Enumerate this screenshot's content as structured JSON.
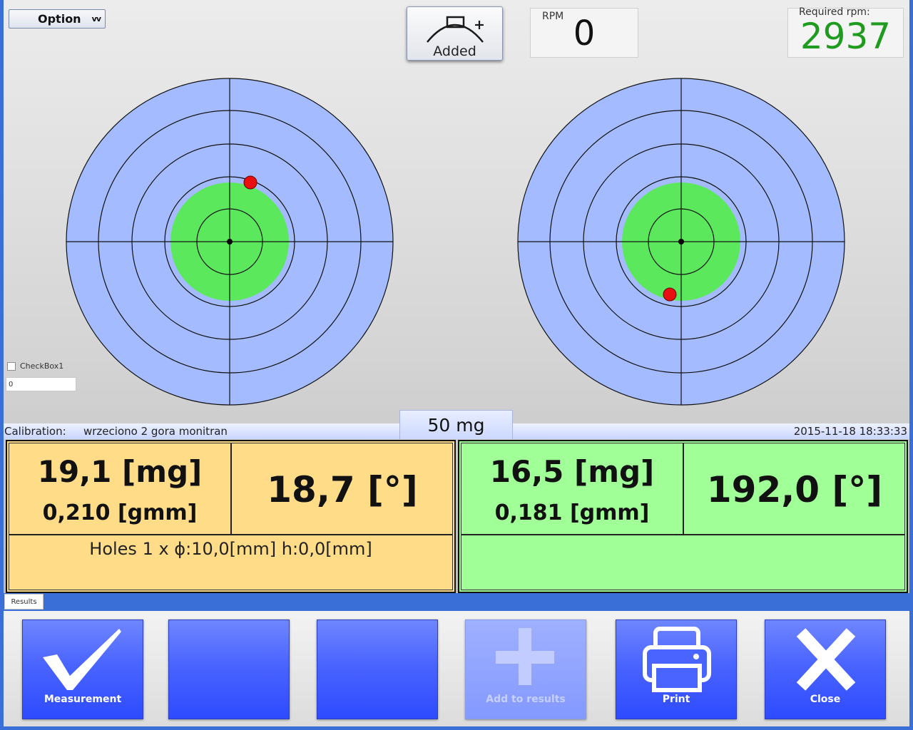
{
  "toolbar": {
    "option_label": "Option",
    "option_chevron": "vv",
    "added_label": "Added"
  },
  "rpm": {
    "caption": "RPM",
    "value": "0"
  },
  "required_rpm": {
    "caption": "Required rpm:",
    "value": "2937"
  },
  "checkbox": {
    "label": "CheckBox1",
    "checked": false
  },
  "input": {
    "value": "0"
  },
  "calibration": {
    "label": "Calibration:",
    "value": "wrzeciono 2 gora monitran",
    "datetime": "2015-11-18 18:33:33"
  },
  "tolerance_tab": {
    "label": "50 mg"
  },
  "left_plane": {
    "mass": "19,1 [mg]",
    "unbalance": "0,210 [gmm]",
    "angle": "18,7 [°]",
    "holes": "Holes  1 x ϕ:10,0[mm] h:0,0[mm]",
    "color": "#ffdc88"
  },
  "right_plane": {
    "mass": "16,5 [mg]",
    "unbalance": "0,181 [gmm]",
    "angle": "192,0 [°]",
    "holes": "",
    "color": "#a0ff96"
  },
  "results_tab": {
    "label": "Results"
  },
  "buttons": {
    "measurement": "Measurement",
    "blank1": "",
    "blank2": "",
    "add_to_results": "Add to results",
    "print": "Print",
    "close": "Close"
  },
  "colors": {
    "target_blue": "#a4bcff",
    "target_green": "#5ce85c",
    "marker_red": "#e81010",
    "button_blue": "#4a64ff",
    "rpm_green": "#1f9b1f"
  },
  "icons": {
    "measurement": "checkmark-icon",
    "add_to_results": "plus-icon",
    "print": "printer-icon",
    "close": "close-x-icon",
    "added": "rotor-added-icon"
  }
}
